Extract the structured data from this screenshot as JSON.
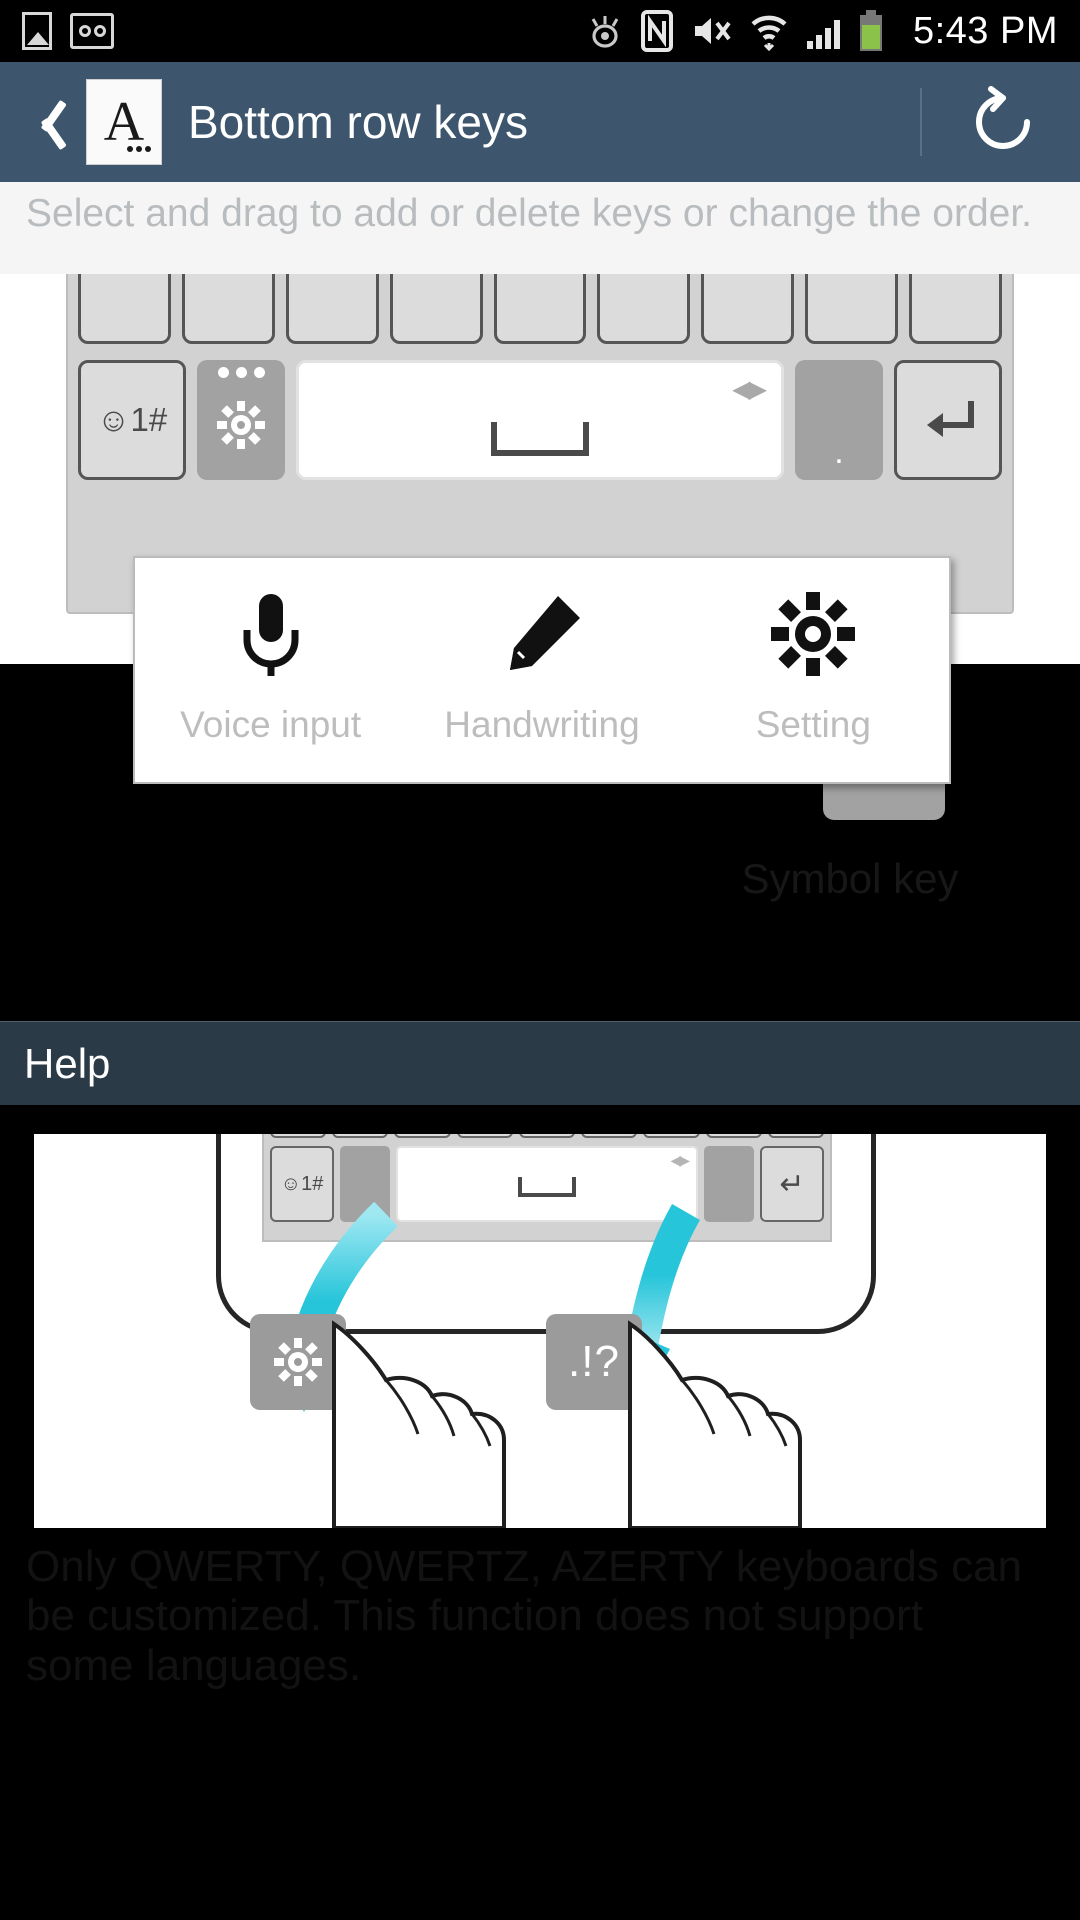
{
  "status_bar": {
    "time": "5:43 PM",
    "left_icons": [
      "image-icon",
      "voicemail-icon"
    ],
    "right_icons": [
      "smart-stay-eye-icon",
      "nfc-icon",
      "mute-icon",
      "wifi-icon",
      "signal-icon",
      "battery-icon"
    ]
  },
  "action_bar": {
    "back_label": "back-chevron-icon",
    "app_icon_letter": "A",
    "title": "Bottom row keys",
    "reset_label": "reset-icon"
  },
  "instruction": {
    "text": "Select and drag to add or delete keys or change the order."
  },
  "preview": {
    "bottom_row_keys": {
      "symbol_key_label": "☺1#",
      "space_key_label": "",
      "period_key_label": ".",
      "enter_key_label": "↵"
    }
  },
  "popup": {
    "items": [
      {
        "icon": "microphone-icon",
        "label": "Voice input"
      },
      {
        "icon": "pencil-icon",
        "label": "Handwriting"
      },
      {
        "icon": "gear-icon",
        "label": "Setting"
      }
    ]
  },
  "symbol_key": {
    "label": "Symbol key"
  },
  "help": {
    "header": "Help",
    "illustration": {
      "symbol_key_label": "☺1#",
      "enter_key_label": "↵",
      "left_key_icon": "gear-icon",
      "right_key_label": ".!?"
    },
    "note": "Only QWERTY, QWERTZ, AZERTY keyboards can be customized. This function does not support some languages."
  },
  "colors": {
    "action_bar": "#3d566e",
    "help_header": "#2b3a47",
    "accent_arrow": "#27c5da",
    "key_grey": "#a2a2a2",
    "instruction_text": "#b9bcbe"
  }
}
